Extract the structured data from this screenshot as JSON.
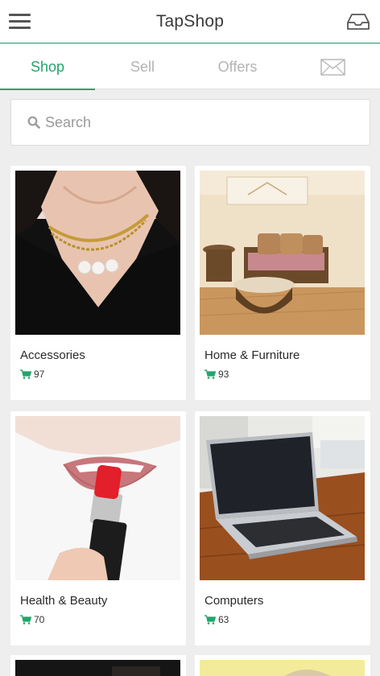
{
  "header": {
    "title": "TapShop",
    "menu_icon": "hamburger-menu-icon",
    "inbox_icon": "inbox-tray-icon"
  },
  "tabs": [
    {
      "label": "Shop",
      "active": true
    },
    {
      "label": "Sell",
      "active": false
    },
    {
      "label": "Offers",
      "active": false
    },
    {
      "label": "",
      "icon": "envelope-icon",
      "active": false
    }
  ],
  "search": {
    "placeholder": "Search",
    "value": "",
    "icon": "search-icon"
  },
  "categories": [
    {
      "name": "Accessories",
      "count": "97",
      "icon": "cart-icon"
    },
    {
      "name": "Home & Furniture",
      "count": "93",
      "icon": "cart-icon"
    },
    {
      "name": "Health & Beauty",
      "count": "70",
      "icon": "cart-icon"
    },
    {
      "name": "Computers",
      "count": "63",
      "icon": "cart-icon"
    }
  ],
  "theme": {
    "accent": "#22a56b",
    "background": "#eeeeee",
    "inactive_tab": "#b3b3b3"
  }
}
